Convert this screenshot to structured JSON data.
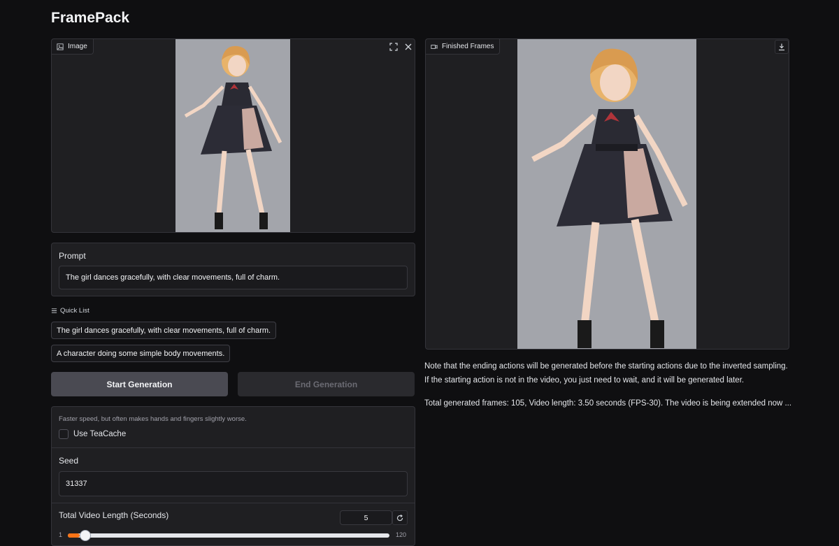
{
  "app": {
    "title": "FramePack"
  },
  "image_panel": {
    "label": "Image",
    "icons": [
      "image-icon",
      "fullscreen-icon",
      "close-icon"
    ]
  },
  "prompt": {
    "label": "Prompt",
    "value": "The girl dances gracefully, with clear movements, full of charm."
  },
  "quick_list": {
    "label": "Quick List",
    "items": [
      "The girl dances gracefully, with clear movements, full of charm.",
      "A character doing some simple body movements."
    ]
  },
  "buttons": {
    "start": "Start Generation",
    "end": "End Generation"
  },
  "teacache": {
    "hint": "Faster speed, but often makes hands and fingers slightly worse.",
    "label": "Use TeaCache",
    "checked": false
  },
  "seed": {
    "label": "Seed",
    "value": "31337"
  },
  "video_length": {
    "label": "Total Video Length (Seconds)",
    "value": "5",
    "min": "1",
    "max": "120"
  },
  "finished_panel": {
    "label": "Finished Frames",
    "icons": [
      "video-icon",
      "download-icon"
    ]
  },
  "notes": {
    "line1": "Note that the ending actions will be generated before the starting actions due to the inverted sampling.",
    "line2": "If the starting action is not in the video, you just need to wait, and it will be generated later.",
    "progress": "Total generated frames: 105, Video length: 3.50 seconds (FPS-30). The video is being extended now ..."
  },
  "colors": {
    "accent": "#f97316",
    "background": "#0f0f11",
    "panel": "#1f1f22"
  }
}
